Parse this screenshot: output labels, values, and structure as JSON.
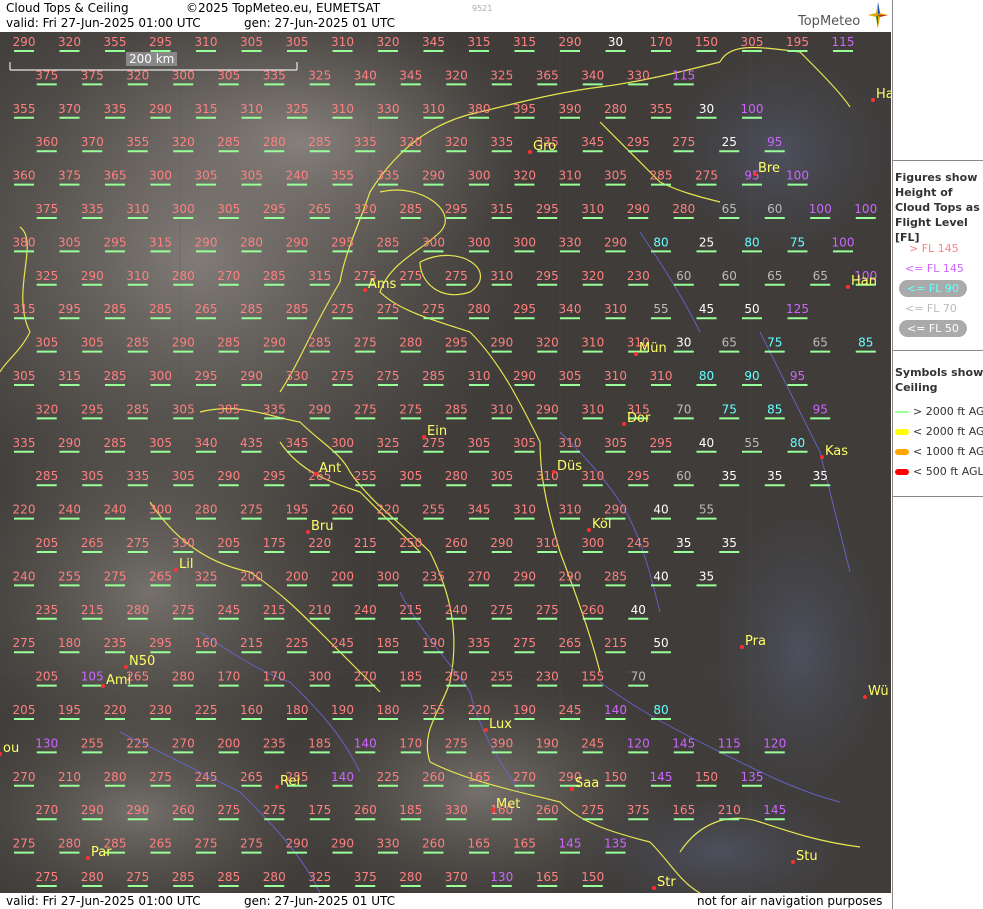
{
  "header": {
    "title": "Cloud Tops & Ceiling",
    "copyright": "©2025 TopMeteo.eu, EUMETSAT",
    "valid": "valid:  Fri  27-Jun-2025  01:00 UTC",
    "gen": "gen: 27-Jun-2025 01 UTC",
    "code": "9521",
    "logo": "TopMeteo"
  },
  "footer": {
    "valid": "valid:  Fri  27-Jun-2025  01:00 UTC",
    "gen": "gen: 27-Jun-2025 01 UTC",
    "note": "not for air navigation purposes"
  },
  "scale_label": "200 km",
  "legend": {
    "title": "Figures show Height of Cloud Tops as Flight Level  [FL]",
    "items": [
      {
        "label": "> FL 145",
        "color": "#ff8080"
      },
      {
        "label": "<= FL 145",
        "color": "#cc66ff"
      },
      {
        "label": "<= FL 90",
        "color": "#66ffff"
      },
      {
        "label": "<= FL 70",
        "color": "#bbbbbb"
      },
      {
        "label": "<= FL 50",
        "color": "#ffffff"
      }
    ],
    "symbols_title": "Symbols show Ceiling",
    "symbols": [
      {
        "label": "> 2000 ft AGL",
        "color": "#99ff99"
      },
      {
        "label": "< 2000 ft AGL",
        "color": "#ffff00"
      },
      {
        "label": "< 1000 ft AGL",
        "color": "#ffa500"
      },
      {
        "label": "< 500 ft AGL",
        "color": "#ff0000"
      }
    ]
  },
  "cities": [
    {
      "n": "Gro"
    },
    {
      "n": "Bre"
    },
    {
      "n": "Ams"
    },
    {
      "n": "Han"
    },
    {
      "n": "Mün"
    },
    {
      "n": "Dor"
    },
    {
      "n": "Ein"
    },
    {
      "n": "Düs"
    },
    {
      "n": "Kas"
    },
    {
      "n": "Ant"
    },
    {
      "n": "Köl"
    },
    {
      "n": "Bru"
    },
    {
      "n": "Lil"
    },
    {
      "n": "Pra"
    },
    {
      "n": "Ami"
    },
    {
      "n": "N50"
    },
    {
      "n": "Lux"
    },
    {
      "n": "Wü"
    },
    {
      "n": "Saa"
    },
    {
      "n": "Rei"
    },
    {
      "n": "Met"
    },
    {
      "n": "Par"
    },
    {
      "n": "Stu"
    },
    {
      "n": "Str"
    },
    {
      "n": "Ha"
    },
    {
      "n": "ou"
    }
  ],
  "rows": [
    [
      "290",
      "320",
      "355",
      "295",
      "310",
      "305",
      "305",
      "310",
      "320",
      "345",
      "315",
      "315",
      "290",
      "30",
      "170",
      "150",
      "305",
      "195",
      "115",
      "75"
    ],
    [
      "375",
      "375",
      "320",
      "300",
      "305",
      "335",
      "325",
      "340",
      "345",
      "320",
      "325",
      "365",
      "340",
      "330",
      "115"
    ],
    [
      "355",
      "370",
      "335",
      "290",
      "315",
      "310",
      "325",
      "310",
      "330",
      "310",
      "380",
      "395",
      "390",
      "280",
      "355",
      "30",
      "100"
    ],
    [
      "360",
      "370",
      "355",
      "320",
      "285",
      "280",
      "285",
      "335",
      "320",
      "320",
      "335",
      "335",
      "345",
      "295",
      "275",
      "25",
      "95"
    ],
    [
      "360",
      "375",
      "365",
      "300",
      "305",
      "305",
      "240",
      "355",
      "335",
      "290",
      "300",
      "320",
      "310",
      "305",
      "285",
      "275",
      "95",
      "100"
    ],
    [
      "375",
      "335",
      "310",
      "300",
      "305",
      "295",
      "265",
      "320",
      "285",
      "295",
      "315",
      "295",
      "310",
      "290",
      "280",
      "65",
      "60",
      "100",
      "100"
    ],
    [
      "380",
      "305",
      "295",
      "315",
      "290",
      "280",
      "290",
      "295",
      "285",
      "300",
      "300",
      "300",
      "330",
      "290",
      "80",
      "25",
      "80",
      "75",
      "100",
      "50"
    ],
    [
      "325",
      "290",
      "310",
      "280",
      "270",
      "285",
      "315",
      "275",
      "275",
      "275",
      "310",
      "295",
      "320",
      "230",
      "60",
      "60",
      "65",
      "65",
      "100"
    ],
    [
      "315",
      "295",
      "285",
      "285",
      "265",
      "285",
      "285",
      "275",
      "275",
      "275",
      "280",
      "295",
      "340",
      "310",
      "55",
      "45",
      "50",
      "125"
    ],
    [
      "305",
      "305",
      "285",
      "290",
      "285",
      "290",
      "285",
      "275",
      "280",
      "295",
      "290",
      "320",
      "310",
      "310",
      "30",
      "65",
      "75",
      "65",
      "85"
    ],
    [
      "305",
      "315",
      "285",
      "300",
      "295",
      "290",
      "330",
      "275",
      "275",
      "285",
      "310",
      "290",
      "305",
      "310",
      "310",
      "80",
      "90",
      "95"
    ],
    [
      "320",
      "295",
      "285",
      "305",
      "385",
      "335",
      "290",
      "275",
      "275",
      "285",
      "310",
      "290",
      "310",
      "315",
      "70",
      "75",
      "85",
      "95"
    ],
    [
      "335",
      "290",
      "285",
      "305",
      "340",
      "435",
      "345",
      "300",
      "325",
      "275",
      "305",
      "305",
      "310",
      "305",
      "295",
      "40",
      "55",
      "80"
    ],
    [
      "285",
      "305",
      "335",
      "305",
      "290",
      "295",
      "265",
      "255",
      "305",
      "280",
      "305",
      "310",
      "310",
      "295",
      "60",
      "35",
      "35",
      "35"
    ],
    [
      "220",
      "240",
      "240",
      "300",
      "280",
      "275",
      "195",
      "260",
      "220",
      "255",
      "345",
      "310",
      "310",
      "290",
      "40",
      "55"
    ],
    [
      "205",
      "265",
      "275",
      "330",
      "205",
      "175",
      "220",
      "215",
      "250",
      "260",
      "290",
      "310",
      "300",
      "245",
      "35",
      "35"
    ],
    [
      "240",
      "255",
      "275",
      "265",
      "325",
      "200",
      "200",
      "200",
      "300",
      "235",
      "270",
      "290",
      "290",
      "285",
      "40",
      "35"
    ],
    [
      "235",
      "215",
      "280",
      "275",
      "245",
      "215",
      "210",
      "240",
      "215",
      "240",
      "275",
      "275",
      "260",
      "40"
    ],
    [
      "275",
      "180",
      "235",
      "295",
      "160",
      "215",
      "225",
      "245",
      "185",
      "190",
      "335",
      "275",
      "265",
      "215",
      "50"
    ],
    [
      "205",
      "105",
      "265",
      "280",
      "170",
      "170",
      "300",
      "270",
      "185",
      "250",
      "255",
      "230",
      "155",
      "70"
    ],
    [
      "205",
      "195",
      "220",
      "230",
      "225",
      "160",
      "180",
      "190",
      "180",
      "255",
      "220",
      "190",
      "245",
      "140",
      "80"
    ],
    [
      "130",
      "255",
      "225",
      "270",
      "200",
      "235",
      "185",
      "140",
      "170",
      "275",
      "390",
      "190",
      "245",
      "120",
      "145",
      "115",
      "120"
    ],
    [
      "270",
      "210",
      "280",
      "275",
      "245",
      "265",
      "285",
      "140",
      "225",
      "260",
      "165",
      "270",
      "290",
      "150",
      "145",
      "150",
      "135"
    ],
    [
      "270",
      "290",
      "290",
      "260",
      "275",
      "275",
      "175",
      "260",
      "185",
      "330",
      "160",
      "260",
      "275",
      "375",
      "165",
      "210",
      "145"
    ],
    [
      "275",
      "280",
      "285",
      "265",
      "275",
      "275",
      "290",
      "290",
      "330",
      "260",
      "165",
      "165",
      "145",
      "135"
    ],
    [
      "275",
      "280",
      "275",
      "285",
      "285",
      "280",
      "325",
      "375",
      "280",
      "370",
      "130",
      "165",
      "150"
    ]
  ]
}
